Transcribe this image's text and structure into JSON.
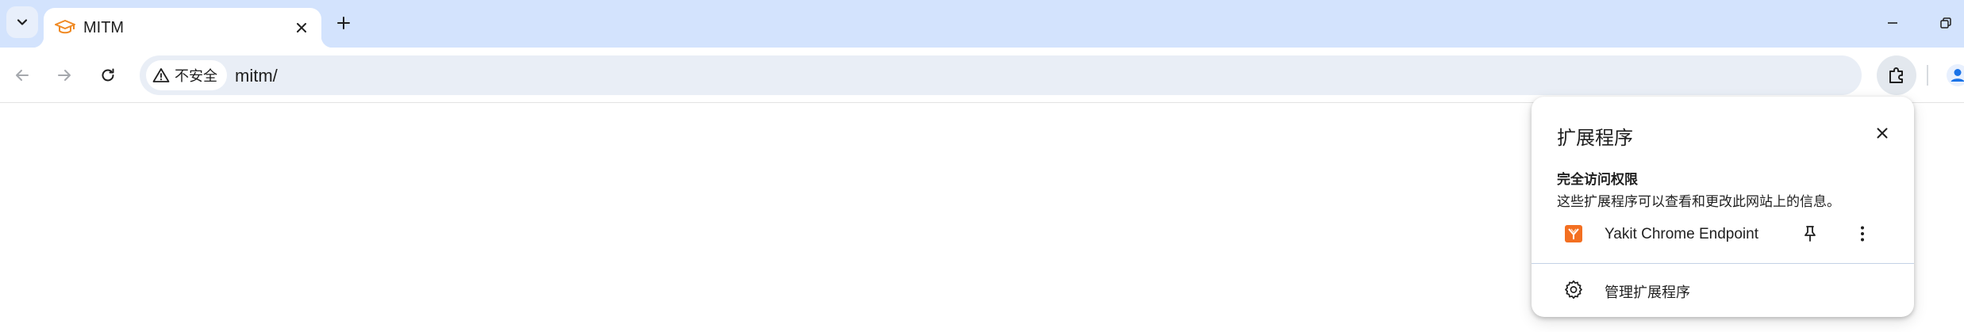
{
  "colors": {
    "tabstrip_bg": "#d3e3fd",
    "omnibox_bg": "#e9eef6",
    "extension_brand": "#f36f21",
    "favicon_color": "#f08a24"
  },
  "tab": {
    "favicon": "mortarboard-icon",
    "title": "MITM"
  },
  "toolbar": {
    "security_label": "不安全",
    "url": "mitm/"
  },
  "extensions_popup": {
    "title": "扩展程序",
    "section_heading": "完全访问权限",
    "section_description": "这些扩展程序可以查看和更改此网站上的信息。",
    "extensions": [
      {
        "name": "Yakit Chrome Endpoint",
        "icon": "yakit-icon"
      }
    ],
    "manage_label": "管理扩展程序"
  }
}
